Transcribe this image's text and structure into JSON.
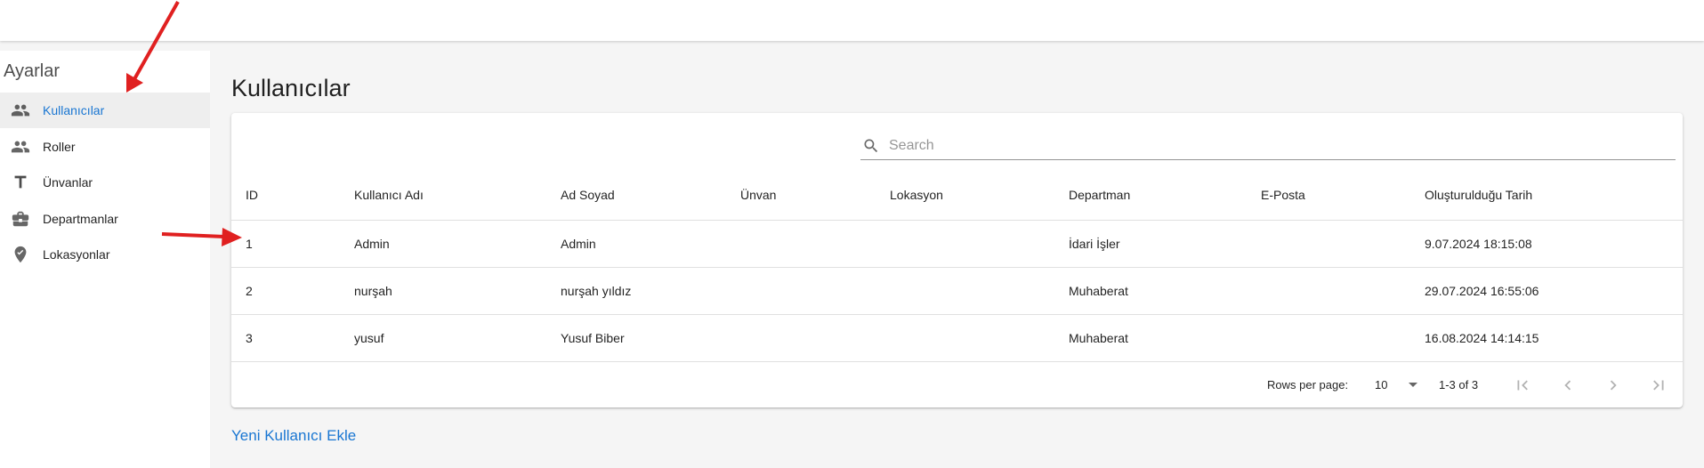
{
  "sidebar": {
    "title": "Ayarlar",
    "items": [
      {
        "label": "Kullanıcılar",
        "icon": "people-icon",
        "active": true
      },
      {
        "label": "Roller",
        "icon": "people-icon",
        "active": false
      },
      {
        "label": "Ünvanlar",
        "icon": "title-icon",
        "active": false
      },
      {
        "label": "Departmanlar",
        "icon": "briefcase-icon",
        "active": false
      },
      {
        "label": "Lokasyonlar",
        "icon": "location-icon",
        "active": false
      }
    ]
  },
  "main": {
    "title": "Kullanıcılar",
    "search": {
      "placeholder": "Search",
      "value": ""
    },
    "table": {
      "columns": [
        "ID",
        "Kullanıcı Adı",
        "Ad Soyad",
        "Ünvan",
        "Lokasyon",
        "Departman",
        "E-Posta",
        "Oluşturulduğu Tarih"
      ],
      "rows": [
        [
          "1",
          "Admin",
          "Admin",
          "",
          "",
          "İdari İşler",
          "",
          "9.07.2024 18:15:08"
        ],
        [
          "2",
          "nurşah",
          "nurşah yıldız",
          "",
          "",
          "Muhaberat",
          "",
          "29.07.2024 16:55:06"
        ],
        [
          "3",
          "yusuf",
          "Yusuf Biber",
          "",
          "",
          "Muhaberat",
          "",
          "16.08.2024 14:14:15"
        ]
      ]
    },
    "pagination": {
      "rows_per_page_label": "Rows per page:",
      "rows_per_page_value": "10",
      "range": "1-3 of 3"
    },
    "add_user_label": "Yeni Kullanıcı Ekle"
  },
  "colors": {
    "accent": "#1976d2",
    "annotation_arrow": "#e02020"
  }
}
